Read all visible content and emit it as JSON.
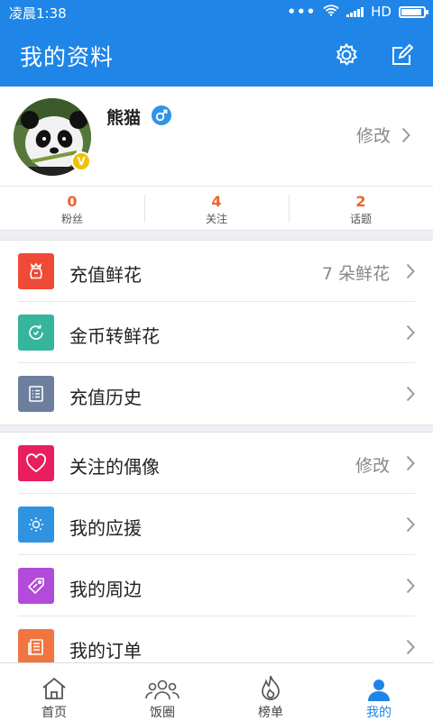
{
  "status_bar": {
    "time": "凌晨1:38",
    "dots": "•••",
    "network": "HD"
  },
  "app_bar": {
    "title": "我的资料",
    "settings_icon": "gear-icon",
    "edit_icon": "edit-icon"
  },
  "profile": {
    "name": "熊猫",
    "gender_symbol": "♂",
    "badge": "V",
    "edit_label": "修改"
  },
  "stats": [
    {
      "value": "0",
      "label": "粉丝"
    },
    {
      "value": "4",
      "label": "关注"
    },
    {
      "value": "2",
      "label": "话题"
    }
  ],
  "menu_group_1": [
    {
      "label": "充值鲜花",
      "value": "7 朵鲜花",
      "icon": "flower-bag-icon",
      "color": "#ef4a36"
    },
    {
      "label": "金币转鲜花",
      "value": "",
      "icon": "refresh-circle-icon",
      "color": "#35b59b"
    },
    {
      "label": "充值历史",
      "value": "",
      "icon": "list-icon",
      "color": "#6d7f9d"
    }
  ],
  "menu_group_2": [
    {
      "label": "关注的偶像",
      "value": "修改",
      "icon": "heart-icon",
      "color": "#e81e5e"
    },
    {
      "label": "我的应援",
      "value": "",
      "icon": "sun-icon",
      "color": "#2f93e0"
    },
    {
      "label": "我的周边",
      "value": "",
      "icon": "tag-icon",
      "color": "#b24bd9"
    },
    {
      "label": "我的订单",
      "value": "",
      "icon": "order-icon",
      "color": "#f07540"
    }
  ],
  "tabs": [
    {
      "label": "首页",
      "icon": "home-icon",
      "active": false
    },
    {
      "label": "饭圈",
      "icon": "group-icon",
      "active": false
    },
    {
      "label": "榜单",
      "icon": "flame-icon",
      "active": false
    },
    {
      "label": "我的",
      "icon": "person-icon",
      "active": true
    }
  ],
  "colors": {
    "primary": "#1f86e8",
    "stat_number": "#f0622d",
    "badge": "#f2c100"
  }
}
